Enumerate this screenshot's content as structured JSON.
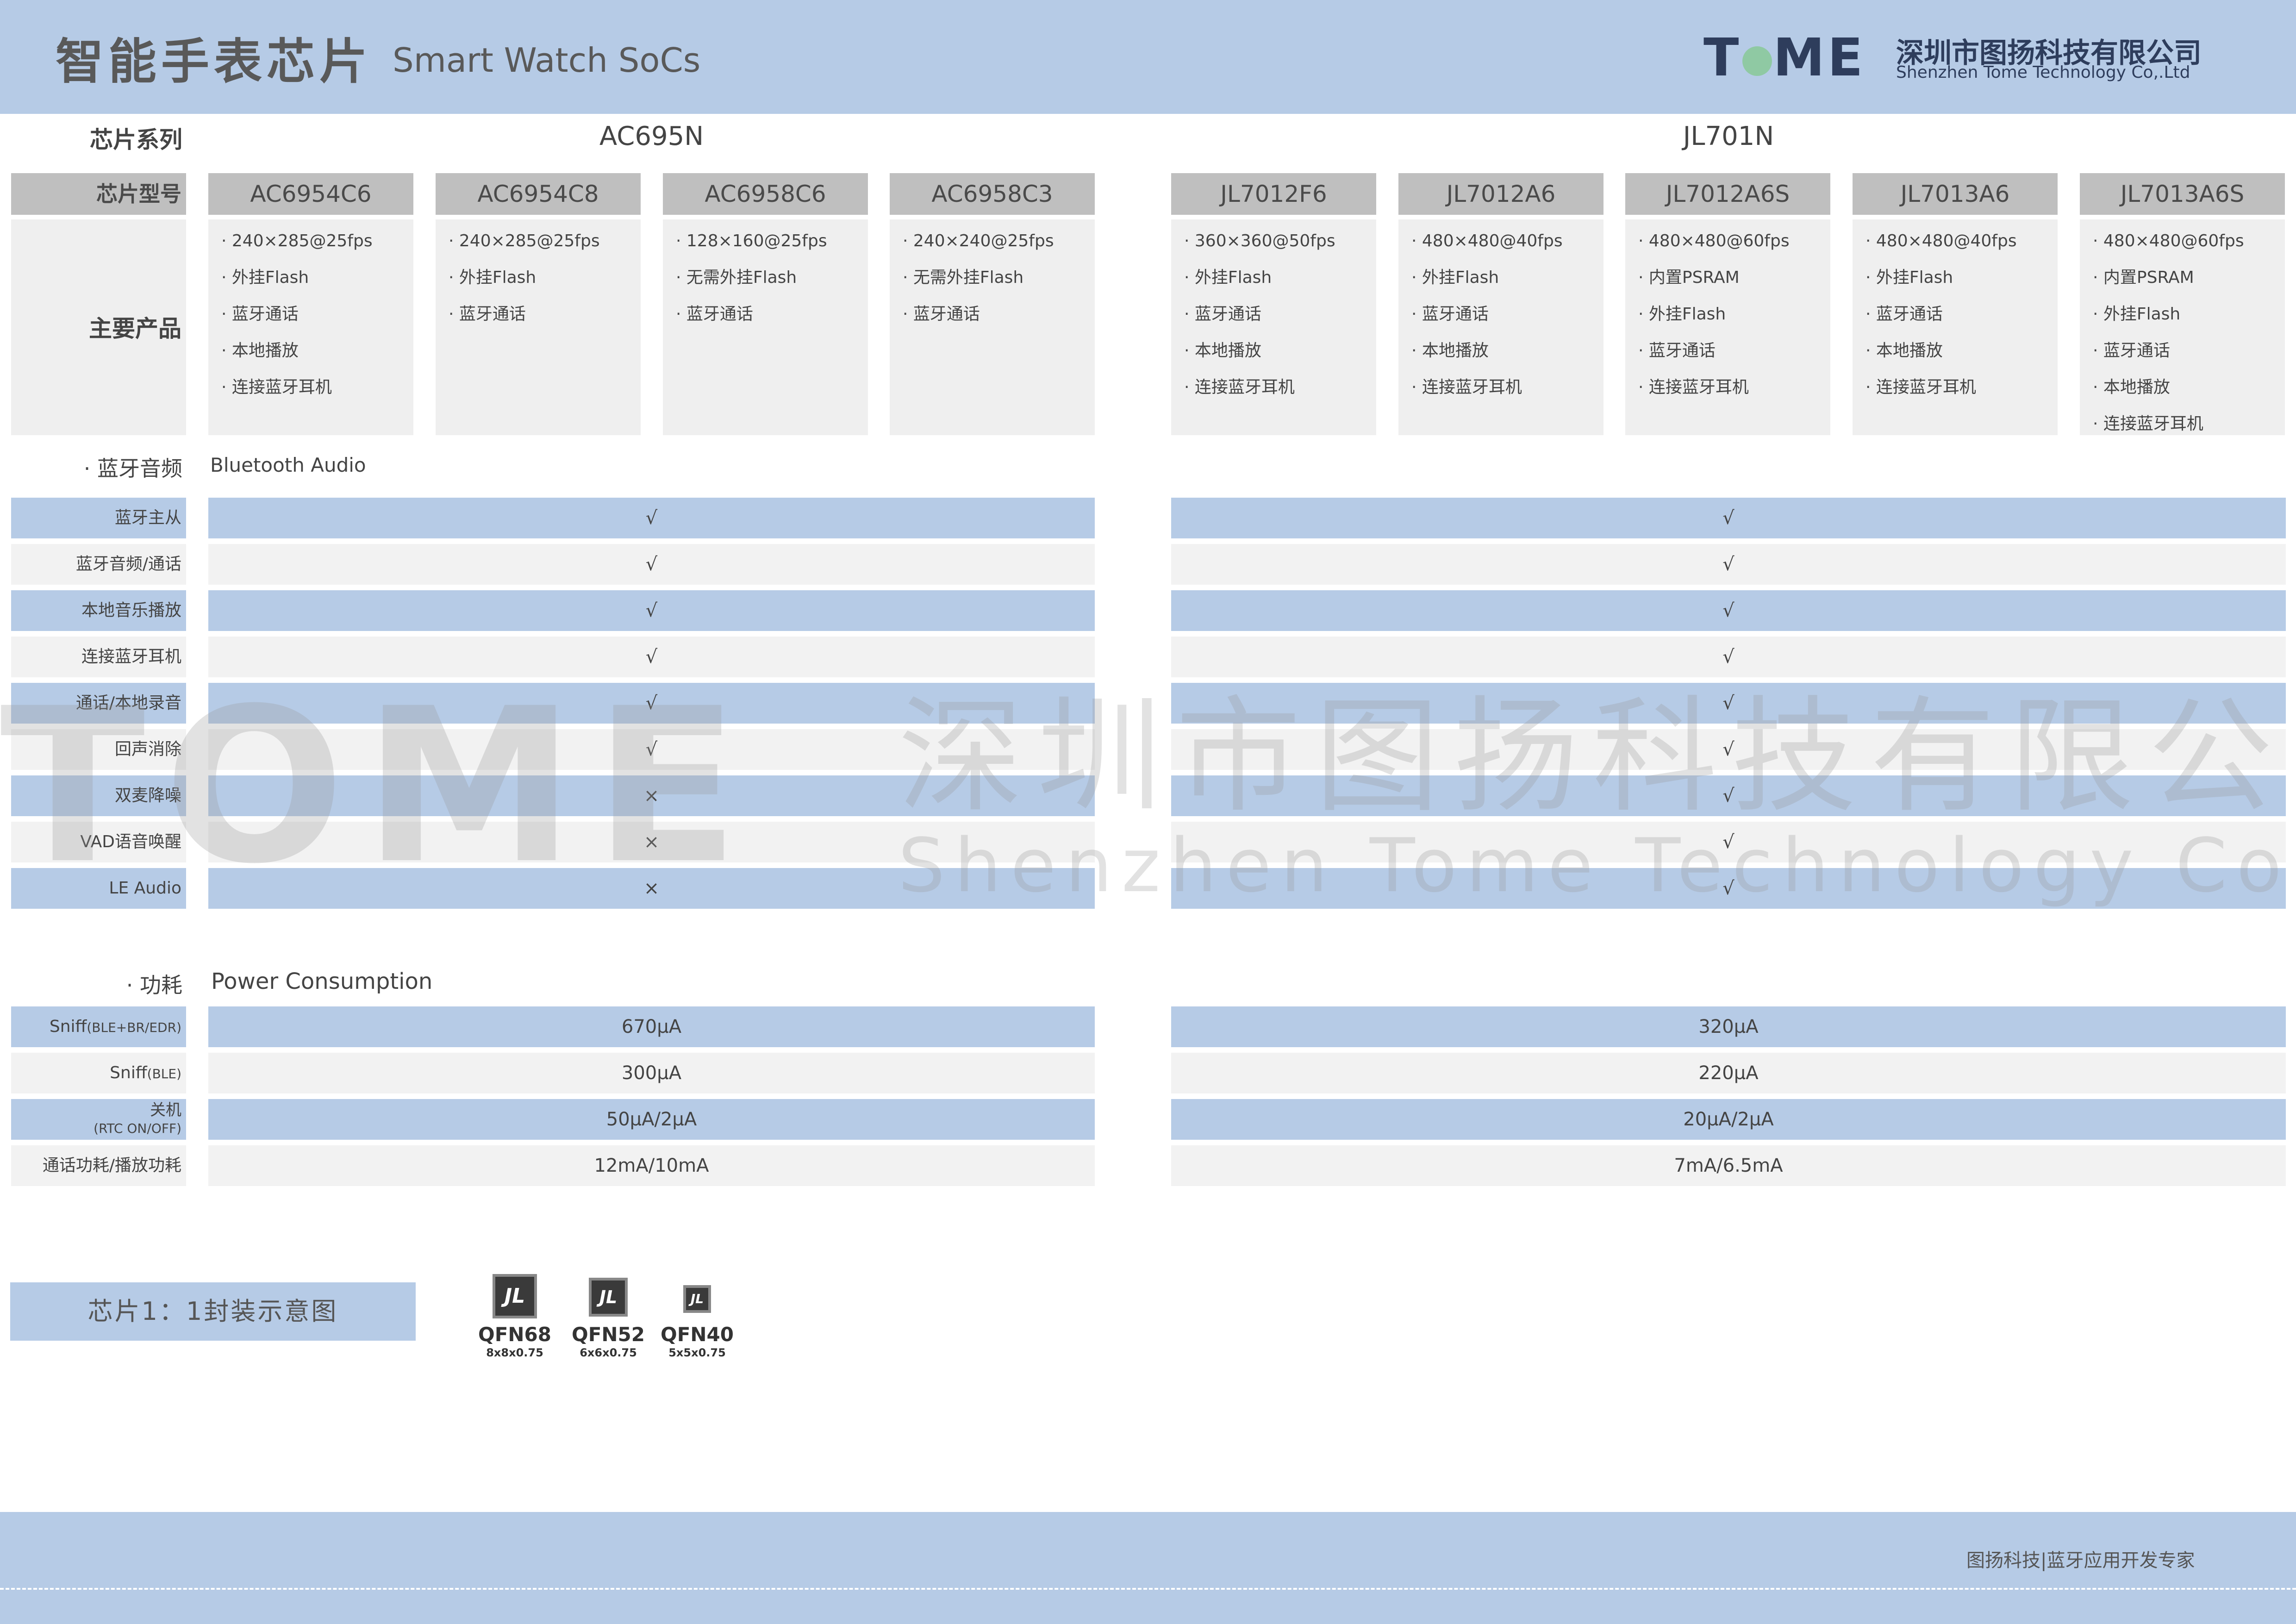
{
  "header": {
    "title_cn": "智能手表芯片",
    "title_en": "Smart Watch SoCs",
    "logo_text_left": "T",
    "logo_text_right": "ME",
    "company_cn": "深圳市图扬科技有限公司",
    "company_en": "Shenzhen Tome Technology Co,.Ltd"
  },
  "series_label": "芯片系列",
  "model_label": "芯片型号",
  "product_label": "主要产品",
  "series": [
    {
      "name": "AC695N",
      "models": [
        {
          "name": "AC6954C6",
          "products": [
            "240×285@25fps",
            "外挂Flash",
            "蓝牙通话",
            "本地播放",
            "连接蓝牙耳机"
          ]
        },
        {
          "name": "AC6954C8",
          "products": [
            "240×285@25fps",
            "外挂Flash",
            "蓝牙通话"
          ]
        },
        {
          "name": "AC6958C6",
          "products": [
            "128×160@25fps",
            "无需外挂Flash",
            "蓝牙通话"
          ]
        },
        {
          "name": "AC6958C3",
          "products": [
            "240×240@25fps",
            "无需外挂Flash",
            "蓝牙通话"
          ]
        }
      ]
    },
    {
      "name": "JL701N",
      "models": [
        {
          "name": "JL7012F6",
          "products": [
            "360×360@50fps",
            "外挂Flash",
            "蓝牙通话",
            "本地播放",
            "连接蓝牙耳机"
          ]
        },
        {
          "name": "JL7012A6",
          "products": [
            "480×480@40fps",
            "外挂Flash",
            "蓝牙通话",
            "本地播放",
            "连接蓝牙耳机"
          ]
        },
        {
          "name": "JL7012A6S",
          "products": [
            "480×480@60fps",
            "内置PSRAM",
            "外挂Flash",
            "蓝牙通话",
            "连接蓝牙耳机"
          ]
        },
        {
          "name": "JL7013A6",
          "products": [
            "480×480@40fps",
            "外挂Flash",
            "蓝牙通话",
            "本地播放",
            "连接蓝牙耳机"
          ]
        },
        {
          "name": "JL7013A6S",
          "products": [
            "480×480@60fps",
            "内置PSRAM",
            "外挂Flash",
            "蓝牙通话",
            "本地播放",
            "连接蓝牙耳机"
          ]
        }
      ]
    }
  ],
  "bluetooth": {
    "title_cn": "蓝牙音频",
    "title_en": "Bluetooth Audio",
    "rows": [
      {
        "label": "蓝牙主从",
        "ac695n": "√",
        "jl701n": "√"
      },
      {
        "label": "蓝牙音频/通话",
        "ac695n": "√",
        "jl701n": "√"
      },
      {
        "label": "本地音乐播放",
        "ac695n": "√",
        "jl701n": "√"
      },
      {
        "label": "连接蓝牙耳机",
        "ac695n": "√",
        "jl701n": "√"
      },
      {
        "label": "通话/本地录音",
        "ac695n": "√",
        "jl701n": "√"
      },
      {
        "label": "回声消除",
        "ac695n": "√",
        "jl701n": "√"
      },
      {
        "label": "双麦降噪",
        "ac695n": "×",
        "jl701n": "√"
      },
      {
        "label": "VAD语音唤醒",
        "ac695n": "×",
        "jl701n": "√"
      },
      {
        "label": "LE Audio",
        "ac695n": "×",
        "jl701n": "√"
      }
    ]
  },
  "power": {
    "title_cn": "功耗",
    "title_en": "Power Consumption",
    "rows": [
      {
        "label": "Sniff",
        "label_small": "(BLE+BR/EDR)",
        "ac695n": "670μA",
        "jl701n": "320μA"
      },
      {
        "label": "Sniff",
        "label_small": "(BLE)",
        "ac695n": "300μA",
        "jl701n": "220μA"
      },
      {
        "label": "关机",
        "label_small": "(RTC ON/OFF)",
        "ac695n": "50μA/2μA",
        "jl701n": "20μA/2μA"
      },
      {
        "label": "通话功耗/播放功耗",
        "label_small": "",
        "ac695n": "12mA/10mA",
        "jl701n": "7mA/6.5mA"
      }
    ]
  },
  "package": {
    "title": "芯片1：1封装示意图",
    "chip_mark": "JL",
    "items": [
      {
        "name": "QFN68",
        "dim": "8x8x0.75"
      },
      {
        "name": "QFN52",
        "dim": "6x6x0.75"
      },
      {
        "name": "QFN40",
        "dim": "5x5x0.75"
      }
    ]
  },
  "watermark": {
    "logo": "TOME",
    "cn": "深圳市图扬科技有限公司",
    "en": "Shenzhen Tome Technology Co,.Ltd"
  },
  "footer": {
    "slogan": "图扬科技|蓝牙应用开发专家"
  },
  "colors": {
    "header_band": "#b6cbe6",
    "row_blue": "#b6cbe6",
    "row_grey": "#f2f2f2",
    "model_header": "#bfbfbf",
    "logo_dark": "#2e3d5c",
    "logo_green": "#8fc9a3"
  }
}
